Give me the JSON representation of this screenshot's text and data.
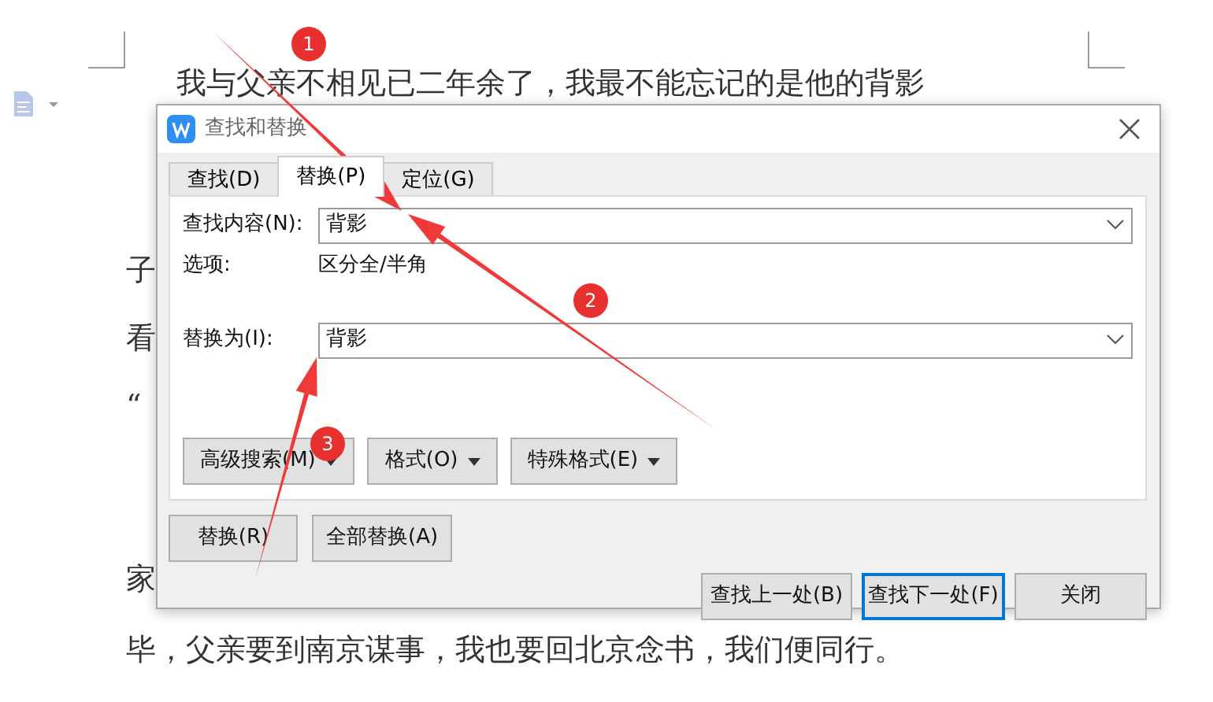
{
  "document": {
    "lines": [
      {
        "text": "我与父亲不相见已二年余了，我最不能忘记的是他的背影"
      },
      {
        "text": "子"
      },
      {
        "text": "看"
      },
      {
        "text": "“"
      },
      {
        "text": "家"
      },
      {
        "text": "毕，父亲要到南京谋事，我也要回北京念书，我们便同行。"
      }
    ]
  },
  "dialog": {
    "title": "查找和替换",
    "tabs": [
      {
        "label": "查找(D)",
        "selected": false
      },
      {
        "label": "替换(P)",
        "selected": true
      },
      {
        "label": "定位(G)",
        "selected": false
      }
    ],
    "find": {
      "label": "查找内容(N):",
      "value": "背影"
    },
    "options": {
      "label": "选项:",
      "value": "区分全/半角"
    },
    "replace": {
      "label": "替换为(I):",
      "value": "背影"
    },
    "option_buttons": [
      "高级搜索(M)",
      "格式(O)",
      "特殊格式(E)"
    ],
    "replace_buttons": [
      "替换(R)",
      "全部替换(A)"
    ],
    "footer_buttons": [
      {
        "label": "查找上一处(B)",
        "focused": false
      },
      {
        "label": "查找下一处(F)",
        "focused": true
      },
      {
        "label": "关闭",
        "focused": false
      }
    ]
  },
  "annotations": [
    {
      "number": "1"
    },
    {
      "number": "2"
    },
    {
      "number": "3"
    }
  ]
}
